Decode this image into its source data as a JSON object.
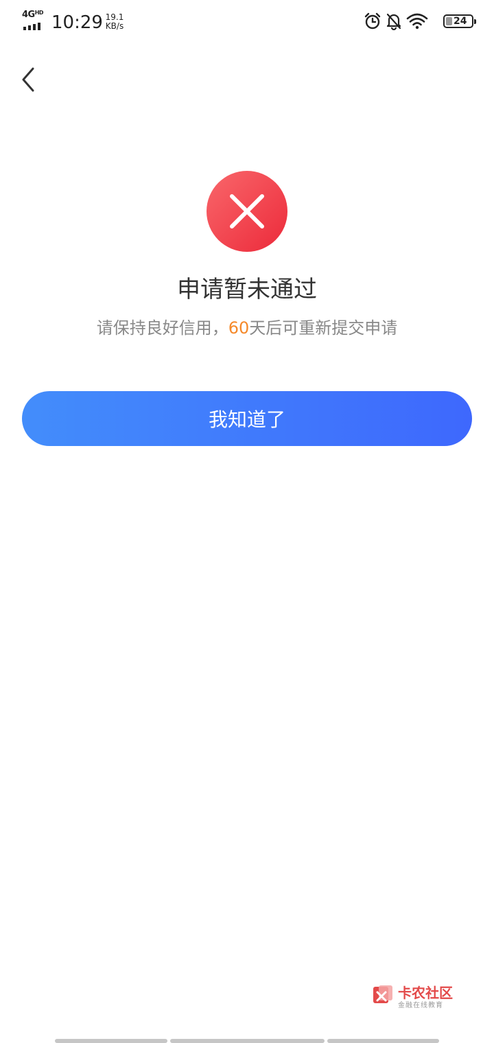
{
  "status_bar": {
    "network": "4G",
    "network_hd": "HD",
    "time": "10:29",
    "speed_value": "19.1",
    "speed_unit": "KB/s",
    "battery": "24",
    "battery_fraction": 0.24
  },
  "status_icons": [
    "alarm-icon",
    "bell-off-icon",
    "wifi-icon",
    "battery-icon"
  ],
  "result": {
    "icon": "close-icon",
    "title": "申请暂未通过",
    "subtitle_before": "请保持良好信用，",
    "subtitle_highlight": "60",
    "subtitle_after": "天后可重新提交申请"
  },
  "actions": {
    "ack_label": "我知道了"
  },
  "watermark": {
    "title": "卡农社区",
    "subtitle": "金融在线教育"
  },
  "colors": {
    "error": "#f04050",
    "highlight": "#f5892a",
    "button_start": "#438dfb",
    "button_end": "#3e68fd"
  }
}
